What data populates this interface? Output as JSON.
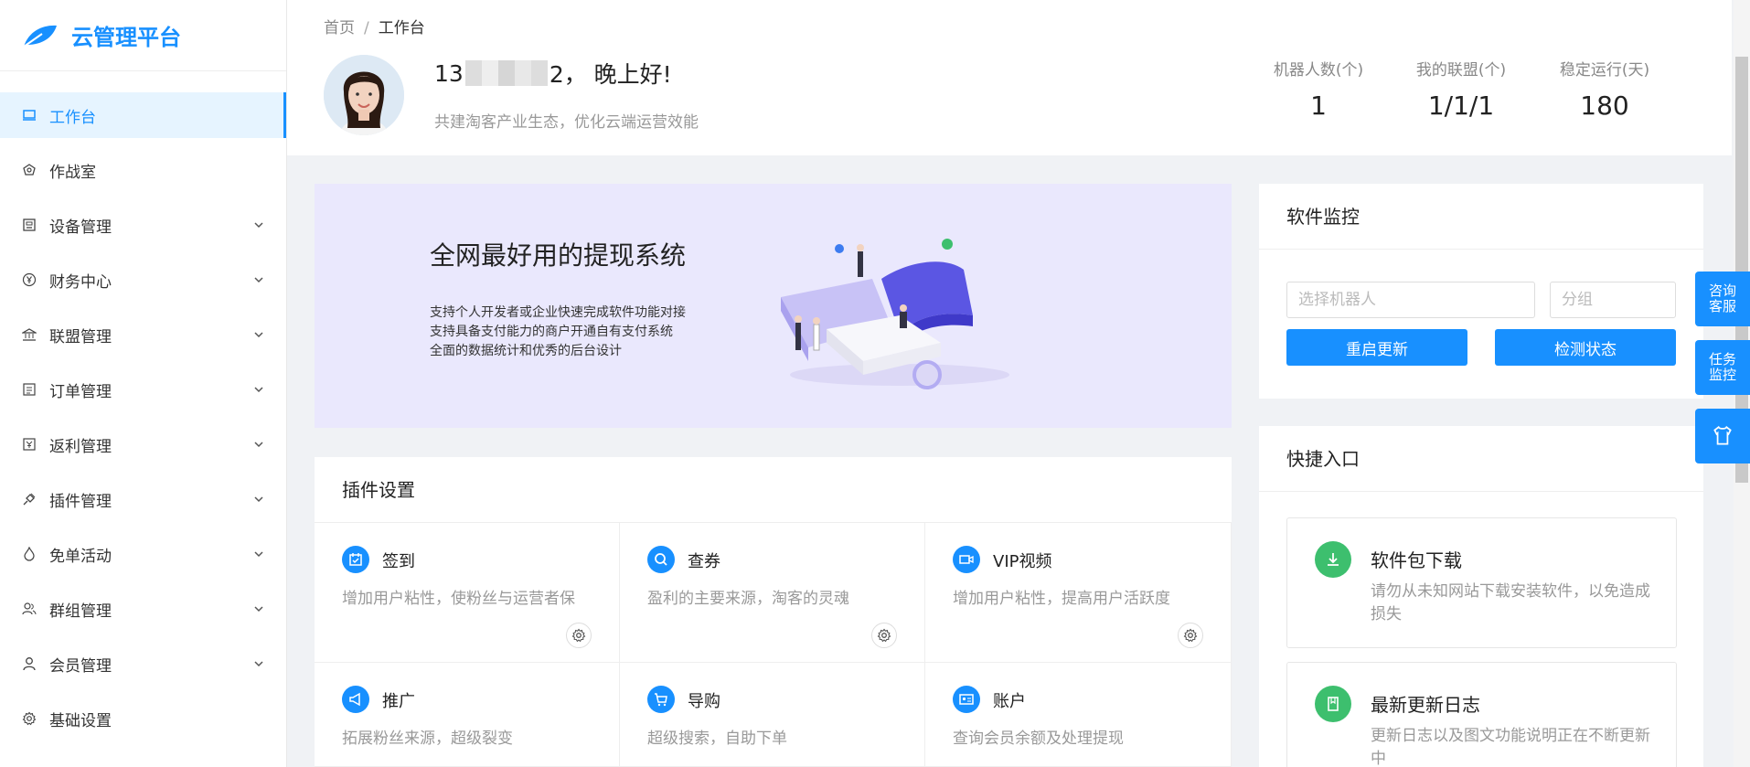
{
  "app": {
    "title": "云管理平台"
  },
  "sidebar": {
    "items": [
      {
        "label": "工作台",
        "icon": "monitor-icon",
        "active": true
      },
      {
        "label": "作战室",
        "icon": "shield-icon"
      },
      {
        "label": "设备管理",
        "icon": "device-icon"
      },
      {
        "label": "财务中心",
        "icon": "yen-icon"
      },
      {
        "label": "联盟管理",
        "icon": "bank-icon"
      },
      {
        "label": "订单管理",
        "icon": "list-icon"
      },
      {
        "label": "返利管理",
        "icon": "rebate-icon"
      },
      {
        "label": "插件管理",
        "icon": "plugin-icon"
      },
      {
        "label": "免单活动",
        "icon": "fire-icon"
      },
      {
        "label": "群组管理",
        "icon": "group-icon"
      },
      {
        "label": "会员管理",
        "icon": "user-icon"
      },
      {
        "label": "基础设置",
        "icon": "gear-icon"
      }
    ]
  },
  "breadcrumb": {
    "home": "首页",
    "separator": "/",
    "current": "工作台"
  },
  "header": {
    "greeting_prefix": "13",
    "greeting_suffix": "2， 晚上好!",
    "slogan": "共建淘客产业生态，优化云端运营效能",
    "stats": [
      {
        "label": "机器人数(个)",
        "value": "1"
      },
      {
        "label": "我的联盟(个)",
        "value": "1/1/1"
      },
      {
        "label": "稳定运行(天)",
        "value": "180"
      }
    ]
  },
  "banner": {
    "title": "全网最好用的提现系统",
    "lines": [
      "支持个人开发者或企业快速完成软件功能对接",
      "支持具备支付能力的商户开通自有支付系统",
      "全面的数据统计和优秀的后台设计"
    ]
  },
  "plugins": {
    "title": "插件设置",
    "items": [
      {
        "name": "签到",
        "desc": "增加用户粘性，使粉丝与运营者保",
        "icon": "calendar-check-icon"
      },
      {
        "name": "查券",
        "desc": "盈利的主要来源，淘客的灵魂",
        "icon": "search-icon"
      },
      {
        "name": "VIP视频",
        "desc": "增加用户粘性，提高用户活跃度",
        "icon": "video-icon"
      },
      {
        "name": "推广",
        "desc": "拓展粉丝来源，超级裂变",
        "icon": "megaphone-icon"
      },
      {
        "name": "导购",
        "desc": "超级搜索，自助下单",
        "icon": "cart-icon"
      },
      {
        "name": "账户",
        "desc": "查询会员余额及处理提现",
        "icon": "id-card-icon"
      }
    ]
  },
  "monitor": {
    "title": "软件监控",
    "robot_placeholder": "选择机器人",
    "group_placeholder": "分组",
    "restart_label": "重启更新",
    "check_label": "检测状态"
  },
  "quick": {
    "title": "快捷入口",
    "items": [
      {
        "name": "软件包下载",
        "desc": "请勿从未知网站下载安装软件，以免造成损失",
        "icon": "download-icon"
      },
      {
        "name": "最新更新日志",
        "desc": "更新日志以及图文功能说明正在不断更新中",
        "icon": "book-icon"
      }
    ]
  },
  "float": {
    "consult": "咨询\n客服",
    "task": "任务\n监控",
    "skin_icon": "shirt-icon"
  },
  "colors": {
    "primary": "#1890ff",
    "green": "#3dbf6e",
    "banner_bg": "#eae8fd"
  }
}
